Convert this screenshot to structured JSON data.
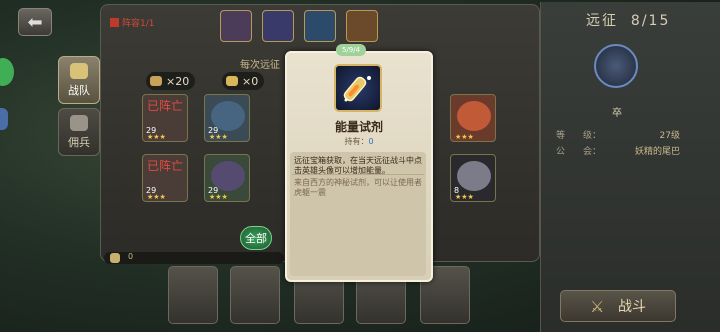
{
  "left_nav": {
    "back_symbol": "⬅",
    "tabs": [
      {
        "label": "战队",
        "icon": "team-icon",
        "active": true
      },
      {
        "label": "佣兵",
        "icon": "mercenary-icon",
        "active": false
      }
    ]
  },
  "lineup": {
    "label": "阵容1/1",
    "slot_icons": [
      "hero-portrait-icon",
      "hero-portrait-icon",
      "hero-portrait-icon",
      "hero-portrait-icon"
    ]
  },
  "counters": [
    {
      "icon": "rocket-icon",
      "value": "×20"
    },
    {
      "icon": "chest-icon",
      "value": "×0"
    }
  ],
  "daily_label": "每次远征",
  "roster": {
    "row1": [
      {
        "dead_text": "已阵亡",
        "level": "29",
        "stars": "★★★"
      },
      {
        "dead_text": "",
        "level": "29",
        "stars": "★★★"
      },
      {
        "dead_text": "",
        "level": "",
        "stars": "★★★"
      }
    ],
    "row2": [
      {
        "dead_text": "已阵亡",
        "level": "29",
        "stars": "★★★"
      },
      {
        "dead_text": "",
        "level": "29",
        "stars": "★★★"
      },
      {
        "dead_text": "",
        "level": "8",
        "stars": "★★★"
      }
    ]
  },
  "all_button": "全部",
  "bottom_bar_value": "0",
  "expedition": {
    "title": "远征",
    "progress": "8/15",
    "enemy_name": "卒",
    "level_label": "等　　级：",
    "level_value": "27级",
    "guild_label": "公　　会：",
    "guild_value": "妖精的尾巴",
    "battle_label": "战斗"
  },
  "popup": {
    "tag": "5/9/4",
    "item_name": "能量试剂",
    "hold_label": "持有：",
    "hold_value": "0",
    "desc_source": "远征宝箱获取，在当天远征战斗中点击英雄头像可以增加能量。",
    "desc_flavor": "来自西方的神秘试剂，可以让使用者虎躯一震"
  },
  "colors": {
    "dead_text": "#e24a3e",
    "hold_value": "#2e72c4",
    "all_button": "#3aa05a"
  }
}
